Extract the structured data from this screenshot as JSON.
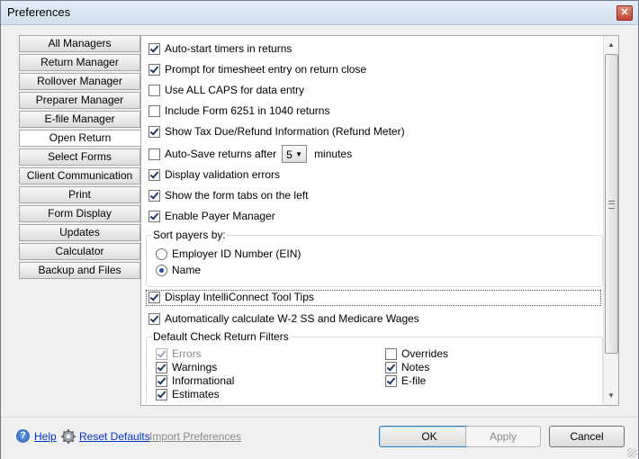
{
  "window": {
    "title": "Preferences",
    "close_glyph": "✕"
  },
  "nav": {
    "items": [
      {
        "label": "All Managers"
      },
      {
        "label": "Return Manager"
      },
      {
        "label": "Rollover Manager"
      },
      {
        "label": "Preparer Manager"
      },
      {
        "label": "E-file Manager"
      },
      {
        "label": "Open Return"
      },
      {
        "label": "Select Forms"
      },
      {
        "label": "Client Communication"
      },
      {
        "label": "Print"
      },
      {
        "label": "Form Display"
      },
      {
        "label": "Updates"
      },
      {
        "label": "Calculator"
      },
      {
        "label": "Backup and Files"
      }
    ],
    "active": "Open Return"
  },
  "options": {
    "auto_start_timers": {
      "label": "Auto-start timers in returns",
      "checked": true
    },
    "prompt_timesheet": {
      "label": "Prompt for timesheet entry on return close",
      "checked": true
    },
    "all_caps": {
      "label": "Use ALL CAPS for data entry",
      "checked": false
    },
    "form_6251": {
      "label": "Include Form 6251 in 1040 returns",
      "checked": false
    },
    "refund_meter": {
      "label": "Show Tax Due/Refund Information (Refund Meter)",
      "checked": true
    },
    "auto_save": {
      "label": "Auto-Save returns after",
      "checked": false,
      "value": "5",
      "suffix": "minutes"
    },
    "validation_errors": {
      "label": "Display validation errors",
      "checked": true
    },
    "form_tabs_left": {
      "label": "Show the form tabs on the left",
      "checked": true
    },
    "payer_manager": {
      "label": "Enable Payer Manager",
      "checked": true
    },
    "intelliconnect_tips": {
      "label": "Display IntelliConnect Tool Tips",
      "checked": true
    },
    "w2_wages": {
      "label": "Automatically calculate W-2 SS and Medicare Wages",
      "checked": true
    }
  },
  "sort_payers": {
    "title": "Sort payers by:",
    "options": [
      {
        "label": "Employer ID Number (EIN)",
        "checked": false
      },
      {
        "label": "Name",
        "checked": true
      }
    ]
  },
  "filters": {
    "title": "Default Check Return Filters",
    "errors": {
      "label": "Errors",
      "checked": true,
      "disabled": true
    },
    "warnings": {
      "label": "Warnings",
      "checked": true
    },
    "informational": {
      "label": "Informational",
      "checked": true
    },
    "estimates": {
      "label": "Estimates",
      "checked": true
    },
    "overrides": {
      "label": "Overrides",
      "checked": false
    },
    "notes": {
      "label": "Notes",
      "checked": true
    },
    "efile": {
      "label": "E-file",
      "checked": true
    }
  },
  "footer": {
    "help": "Help",
    "reset_defaults": "Reset Defaults",
    "import_preferences": "Import Preferences",
    "ok": "OK",
    "apply": "Apply",
    "cancel": "Cancel"
  },
  "icons": {
    "help": "help-icon",
    "reset": "gear-icon",
    "scroll_up": "▲",
    "scroll_down": "▼",
    "dropdown": "▼"
  },
  "colors": {
    "link": "#0033cc",
    "titlebar": "#d3dfee"
  }
}
